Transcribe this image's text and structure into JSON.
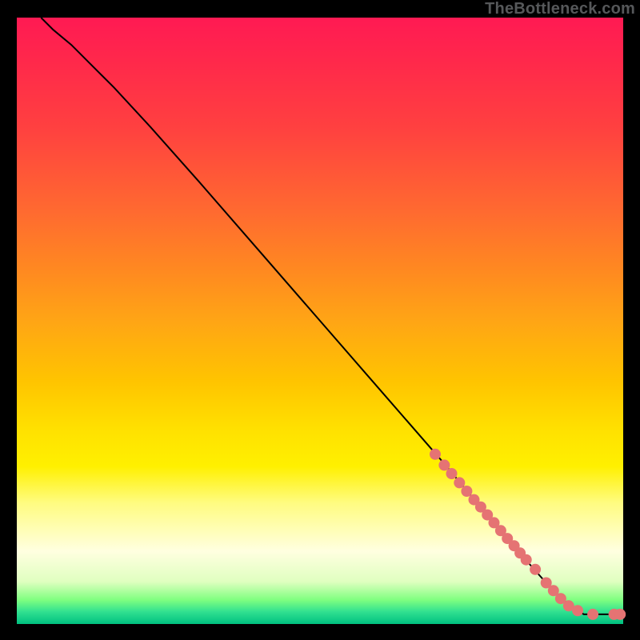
{
  "attribution": "TheBottleneck.com",
  "chart_data": {
    "type": "line",
    "title": "",
    "xlabel": "",
    "ylabel": "",
    "xlim": [
      0,
      100
    ],
    "ylim": [
      0,
      100
    ],
    "curve": [
      {
        "x": 4.0,
        "y": 100.0
      },
      {
        "x": 6.0,
        "y": 98.0
      },
      {
        "x": 9.0,
        "y": 95.5
      },
      {
        "x": 12.0,
        "y": 92.5
      },
      {
        "x": 16.0,
        "y": 88.5
      },
      {
        "x": 22.0,
        "y": 82.0
      },
      {
        "x": 30.0,
        "y": 73.0
      },
      {
        "x": 40.0,
        "y": 61.5
      },
      {
        "x": 50.0,
        "y": 50.0
      },
      {
        "x": 60.0,
        "y": 38.5
      },
      {
        "x": 70.0,
        "y": 27.0
      },
      {
        "x": 78.0,
        "y": 17.5
      },
      {
        "x": 84.0,
        "y": 10.5
      },
      {
        "x": 88.0,
        "y": 6.0
      },
      {
        "x": 91.0,
        "y": 3.2
      },
      {
        "x": 93.5,
        "y": 1.6
      },
      {
        "x": 96.5,
        "y": 1.6
      },
      {
        "x": 99.0,
        "y": 1.6
      }
    ],
    "series": [
      {
        "name": "points",
        "color": "#e57373",
        "markers": [
          {
            "x": 69.0,
            "y": 28.0
          },
          {
            "x": 70.5,
            "y": 26.2
          },
          {
            "x": 71.7,
            "y": 24.8
          },
          {
            "x": 73.0,
            "y": 23.3
          },
          {
            "x": 74.2,
            "y": 21.9
          },
          {
            "x": 75.4,
            "y": 20.5
          },
          {
            "x": 76.5,
            "y": 19.3
          },
          {
            "x": 77.6,
            "y": 18.0
          },
          {
            "x": 78.7,
            "y": 16.7
          },
          {
            "x": 79.8,
            "y": 15.4
          },
          {
            "x": 80.9,
            "y": 14.1
          },
          {
            "x": 82.0,
            "y": 12.9
          },
          {
            "x": 83.0,
            "y": 11.7
          },
          {
            "x": 84.0,
            "y": 10.6
          },
          {
            "x": 85.5,
            "y": 9.0
          },
          {
            "x": 87.3,
            "y": 6.8
          },
          {
            "x": 88.5,
            "y": 5.5
          },
          {
            "x": 89.7,
            "y": 4.2
          },
          {
            "x": 91.0,
            "y": 3.0
          },
          {
            "x": 92.5,
            "y": 2.2
          },
          {
            "x": 95.0,
            "y": 1.6
          },
          {
            "x": 98.5,
            "y": 1.6
          },
          {
            "x": 99.5,
            "y": 1.6
          }
        ]
      }
    ]
  }
}
